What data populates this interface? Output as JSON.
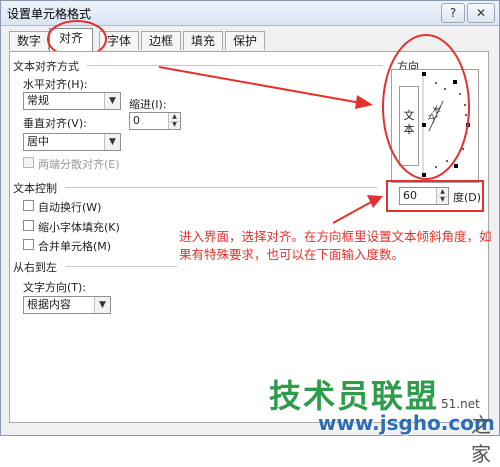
{
  "window": {
    "title": "设置单元格格式",
    "help_label": "?",
    "close_label": "✕"
  },
  "tabs": [
    {
      "label": "数字"
    },
    {
      "label": "对齐"
    },
    {
      "label": "字体"
    },
    {
      "label": "边框"
    },
    {
      "label": "填充"
    },
    {
      "label": "保护"
    }
  ],
  "alignment": {
    "section_title": "文本对齐方式",
    "horizontal_label": "水平对齐(H):",
    "horizontal_value": "常规",
    "indent_label": "缩进(I):",
    "indent_value": "0",
    "vertical_label": "垂直对齐(V):",
    "vertical_value": "居中",
    "distributed_label": "两端分散对齐(E)"
  },
  "control": {
    "section_title": "文本控制",
    "wrap_label": "自动换行(W)",
    "shrink_label": "缩小字体填充(K)",
    "merge_label": "合并单元格(M)"
  },
  "rtl": {
    "section_title": "从右到左",
    "direction_label": "文字方向(T):",
    "direction_value": "根据内容"
  },
  "orientation": {
    "title": "方向",
    "vertical_text": "文本",
    "needle_text": "文本",
    "degrees_value": "60",
    "degrees_label": "度(D)"
  },
  "annotation": {
    "text": "进入界面，选择对齐。在方向框里设置文本倾斜角度，如果有特殊要求，也可以在下面输入度数。",
    "color": "#e5312d"
  },
  "watermark": {
    "brand": "技术员联盟",
    "url": "www.jsgho.com",
    "partial": "51.net",
    "corner": "之家"
  }
}
